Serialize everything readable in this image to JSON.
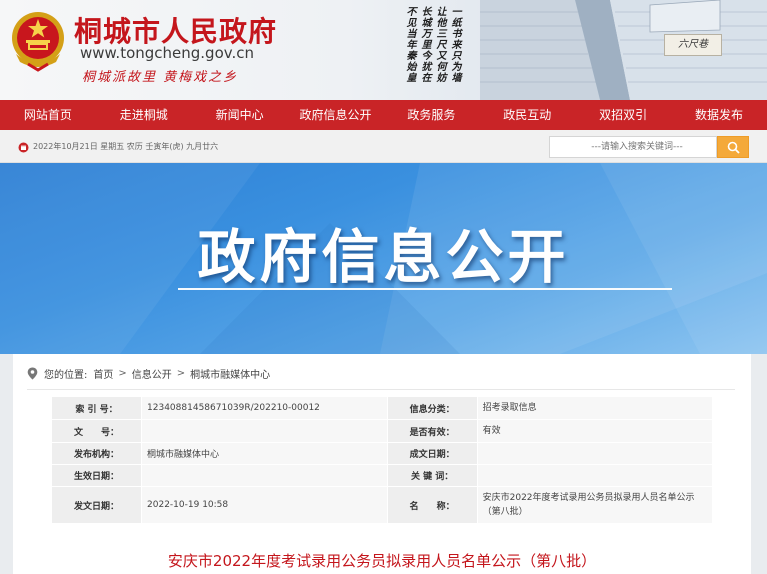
{
  "header": {
    "site_name": "桐城市人民政府",
    "site_url": "www.tongcheng.gov.cn",
    "slogan": "桐城派故里  黄梅戏之乡",
    "poem_columns": [
      "一纸书来只为墙",
      "让他三尺又何妨",
      "长城万里今犹在",
      "不见当年秦始皇"
    ],
    "lane_sign": "六尺巷"
  },
  "nav": {
    "items": [
      "网站首页",
      "走进桐城",
      "新闻中心",
      "政府信息公开",
      "政务服务",
      "政民互动",
      "双招双引",
      "数据发布"
    ]
  },
  "infobar": {
    "date_text": "2022年10月21日 星期五 农历 壬寅年(虎) 九月廿六",
    "search_placeholder": "---请输入搜索关键词---"
  },
  "banner": {
    "title": "政府信息公开"
  },
  "breadcrumb": {
    "prefix": "您的位置:",
    "items": [
      "首页",
      "信息公开",
      "桐城市融媒体中心"
    ]
  },
  "meta": {
    "rows": [
      {
        "l1": "索 引 号：",
        "v1": "12340881458671039R/202210-00012",
        "l2": "信息分类：",
        "v2": "招考录取信息"
      },
      {
        "l1": "文　　号：",
        "v1": "",
        "l2": "是否有效：",
        "v2": "有效"
      },
      {
        "l1": "发布机构：",
        "v1": "桐城市融媒体中心",
        "l2": "成文日期：",
        "v2": ""
      },
      {
        "l1": "生效日期：",
        "v1": "",
        "l2": "关 键 词：",
        "v2": ""
      },
      {
        "l1": "发文日期：",
        "v1": "2022-10-19 10:58",
        "l2": "名　　称：",
        "v2": "安庆市2022年度考试录用公务员拟录用人员名单公示（第八批）"
      }
    ]
  },
  "document": {
    "title": "安庆市2022年度考试录用公务员拟录用人员名单公示（第八批）"
  },
  "colors": {
    "brand_red": "#c92427",
    "title_red": "#c4161c",
    "search_orange": "#f4a93a",
    "banner_blue": "#2d7fd4"
  },
  "icons": {
    "emblem": "national-emblem-icon",
    "calendar": "calendar-icon",
    "search": "search-icon",
    "location": "location-pin-icon"
  }
}
